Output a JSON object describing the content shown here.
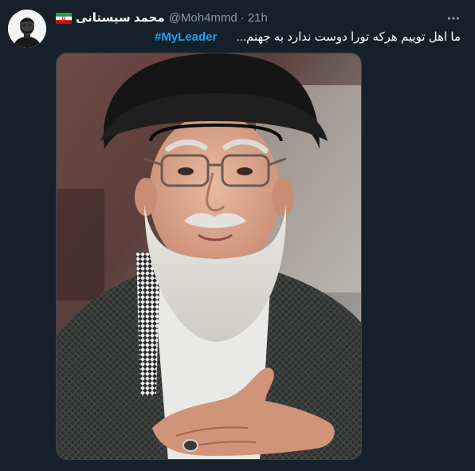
{
  "tweet": {
    "display_name": "محمد سیستانی",
    "handle": "@Moh4mmd",
    "separator": "·",
    "time": "21h",
    "text": "ما اهل توییم هرکه تورا دوست ندارد به جهنم...",
    "hashtag": "#MyLeader",
    "flag_icon": "iran-flag-icon",
    "more_icon": "more-options-icon"
  },
  "colors": {
    "background": "#15202b",
    "primary_text": "#ffffff",
    "secondary_text": "#8899a6",
    "link": "#1da1f2",
    "border": "#38444d"
  }
}
